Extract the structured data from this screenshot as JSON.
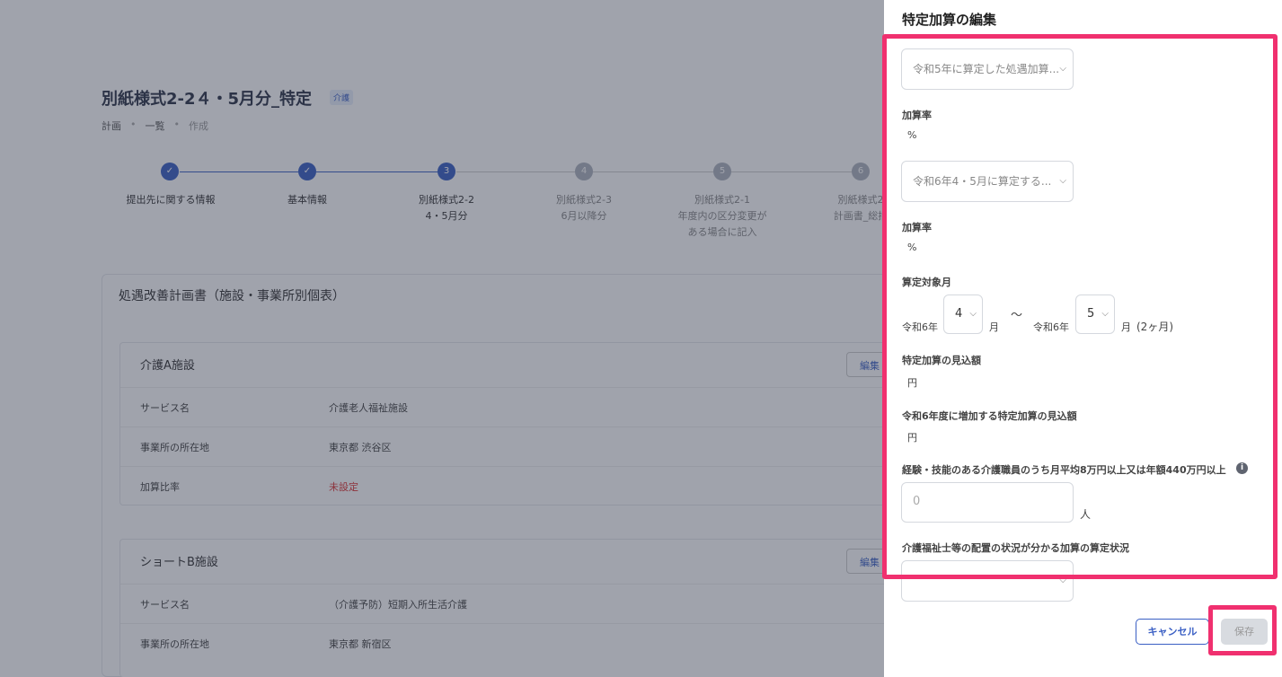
{
  "background_page": {
    "title": "別紙様式2-2４・5月分_特定",
    "tag": "介護",
    "breadcrumb": [
      "計画",
      "一覧",
      "作成"
    ],
    "steps": [
      {
        "number": "✓",
        "label_line1": "提出先に関する情報",
        "label_line2": "",
        "label_line3": ""
      },
      {
        "number": "✓",
        "label_line1": "基本情報",
        "label_line2": "",
        "label_line3": ""
      },
      {
        "number": "3",
        "label_line1": "別紙様式2-2",
        "label_line2": "4・5月分",
        "label_line3": ""
      },
      {
        "number": "4",
        "label_line1": "別紙様式2-3",
        "label_line2": "6月以降分",
        "label_line3": ""
      },
      {
        "number": "5",
        "label_line1": "別紙様式2-1",
        "label_line2": "年度内の区分変更が",
        "label_line3": "ある場合に記入"
      },
      {
        "number": "6",
        "label_line1": "別紙様式2",
        "label_line2": "計画書_総括",
        "label_line3": ""
      }
    ],
    "section_title": "処遇改善計画書（施設・事業所別個表）",
    "edit_label": "編集",
    "facilities": [
      {
        "name": "介護A施設",
        "rows": [
          {
            "label": "サービス名",
            "value": "介護老人福祉施設"
          },
          {
            "label": "事業所の所在地",
            "value": "東京都 渋谷区"
          },
          {
            "label": "加算比率",
            "value": "未設定"
          }
        ]
      },
      {
        "name": "ショートB施設",
        "rows": [
          {
            "label": "サービス名",
            "value": "（介護予防）短期入所生活介護"
          },
          {
            "label": "事業所の所在地",
            "value": "東京都 新宿区"
          }
        ]
      }
    ]
  },
  "drawer": {
    "title": "特定加算の編集",
    "select1_placeholder": "令和5年に算定した処遇加算...",
    "rate_label_1": "加算率",
    "rate_unit_1": "%",
    "select2_placeholder": "令和6年4・5月に算定する...",
    "rate_label_2": "加算率",
    "rate_unit_2": "%",
    "target_month_label": "算定対象月",
    "from_era": "令和6年",
    "from_month": "4",
    "month_unit": "月",
    "tilde": "〜",
    "to_era": "令和6年",
    "to_month": "5",
    "duration": "(2ヶ月)",
    "expected_label": "特定加算の見込額",
    "expected_unit": "円",
    "increase_label": "令和6年度に増加する特定加算の見込額",
    "increase_unit": "円",
    "staff_label": "経験・技能のある介護職員のうち月平均8万円以上又は年額440万円以上",
    "staff_placeholder": "0",
    "staff_unit": "人",
    "placement_label": "介護福祉士等の配置の状況が分かる加算の算定状況",
    "placement_value": "",
    "cancel_label": "キャンセル",
    "save_label": "保存"
  },
  "icons": {
    "chevron": "chevron-down-icon",
    "info": "info-icon",
    "check": "check-icon"
  },
  "colors": {
    "primary": "#3a5fc4",
    "highlight": "#f0306f",
    "overlay": "rgba(45,52,70,0.45)",
    "error": "#dd3333"
  }
}
